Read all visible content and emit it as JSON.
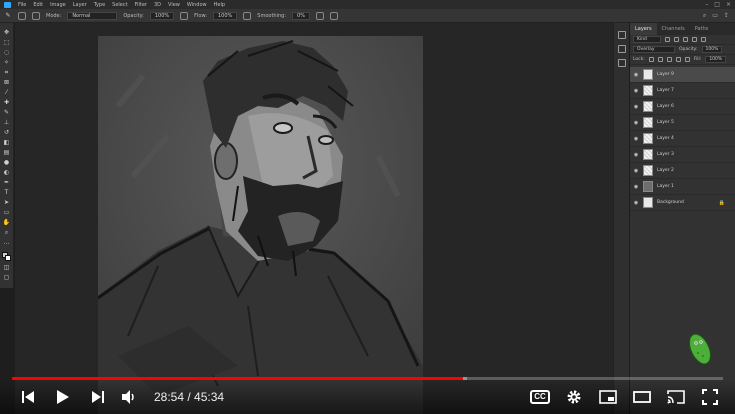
{
  "photoshop": {
    "menu": [
      "File",
      "Edit",
      "Image",
      "Layer",
      "Type",
      "Select",
      "Filter",
      "3D",
      "View",
      "Window",
      "Help"
    ],
    "options": {
      "mode_label": "Mode:",
      "mode_value": "Normal",
      "opacity_label": "Opacity:",
      "opacity_value": "100%",
      "flow_label": "Flow:",
      "flow_value": "100%",
      "smoothing_label": "Smoothing:",
      "smoothing_value": "0%"
    },
    "panel": {
      "tabs": [
        "Layers",
        "Channels",
        "Paths"
      ],
      "kind_label": "Kind",
      "blend_value": "Overlay",
      "opacity_label": "Opacity:",
      "opacity_value": "100%",
      "lock_label": "Lock:",
      "fill_label": "Fill:",
      "fill_value": "100%",
      "layers": [
        {
          "name": "Layer 9",
          "thumb": "white",
          "selected": true
        },
        {
          "name": "Layer 7",
          "thumb": "brush",
          "selected": false
        },
        {
          "name": "Layer 6",
          "thumb": "sketch",
          "selected": false
        },
        {
          "name": "Layer 5",
          "thumb": "sketch",
          "selected": false
        },
        {
          "name": "Layer 4",
          "thumb": "sketch",
          "selected": false
        },
        {
          "name": "Layer 3",
          "thumb": "sketch",
          "selected": false
        },
        {
          "name": "Layer 2",
          "thumb": "sketch",
          "selected": false
        },
        {
          "name": "Layer 1",
          "thumb": "dark",
          "selected": false
        },
        {
          "name": "Background",
          "thumb": "white",
          "selected": false
        }
      ]
    }
  },
  "player": {
    "current_time": "28:54",
    "duration": "45:34",
    "time_display": "28:54 / 45:34",
    "played_fraction": 0.634,
    "loaded_fraction": 0.64,
    "cc_label": "CC",
    "progress_color": "#ff0000"
  }
}
